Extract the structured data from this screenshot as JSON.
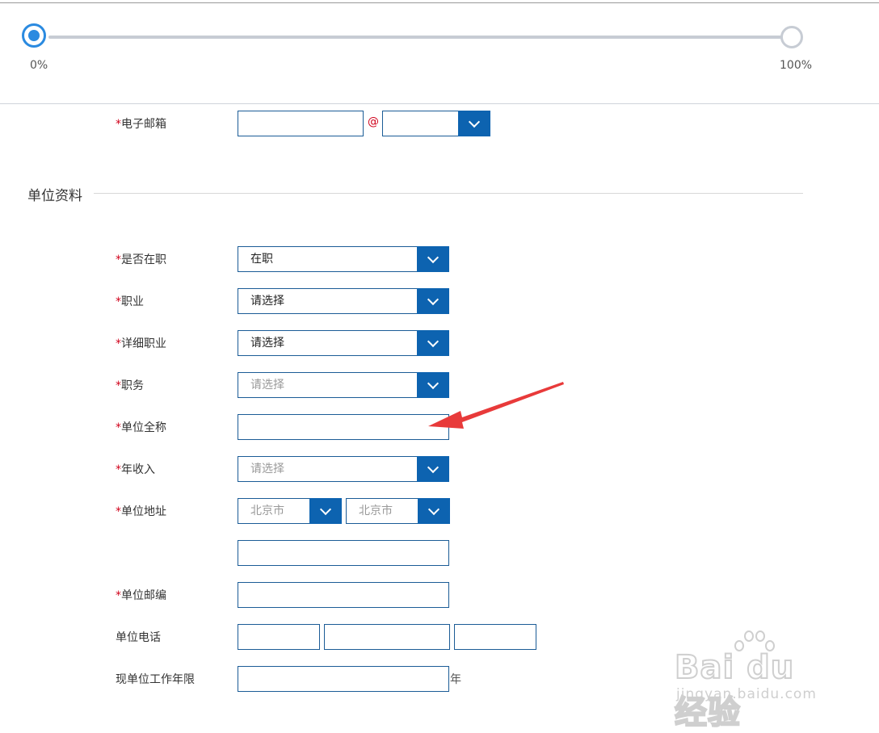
{
  "progress": {
    "value_percent": 0,
    "start_label": "0%",
    "end_label": "100%",
    "accent_color": "#2a8ae0"
  },
  "email": {
    "label": "电子邮箱",
    "required_mark": "*",
    "at_sign": "@",
    "local_value": "",
    "domain_value": ""
  },
  "section": {
    "title": "单位资料"
  },
  "fields": {
    "employed": {
      "label": "是否在职",
      "required": "*",
      "value": "在职"
    },
    "occupation": {
      "label": "职业",
      "required": "*",
      "value": "请选择"
    },
    "detail_occupation": {
      "label": "详细职业",
      "required": "*",
      "value": "请选择"
    },
    "position": {
      "label": "职务",
      "required": "*",
      "placeholder": "请选择"
    },
    "company_name": {
      "label": "单位全称",
      "required": "*",
      "value": ""
    },
    "annual_income": {
      "label": "年收入",
      "required": "*",
      "placeholder": "请选择"
    },
    "company_address": {
      "label": "单位地址",
      "required": "*",
      "province": "北京市",
      "city": "北京市",
      "detail": ""
    },
    "postcode": {
      "label": "单位邮编",
      "required": "*",
      "value": ""
    },
    "phone": {
      "label": "单位电话",
      "area": "",
      "number": "",
      "ext": ""
    },
    "years": {
      "label": "现单位工作年限",
      "value": "",
      "unit": "年"
    }
  },
  "watermark": {
    "logo_text": "Bai du 经验",
    "url_text": "jingyan.baidu.com"
  },
  "colors": {
    "border": "#1b5c96",
    "button": "#0d63b0",
    "required": "#d0021b",
    "annotation_arrow": "#e83a3a"
  }
}
